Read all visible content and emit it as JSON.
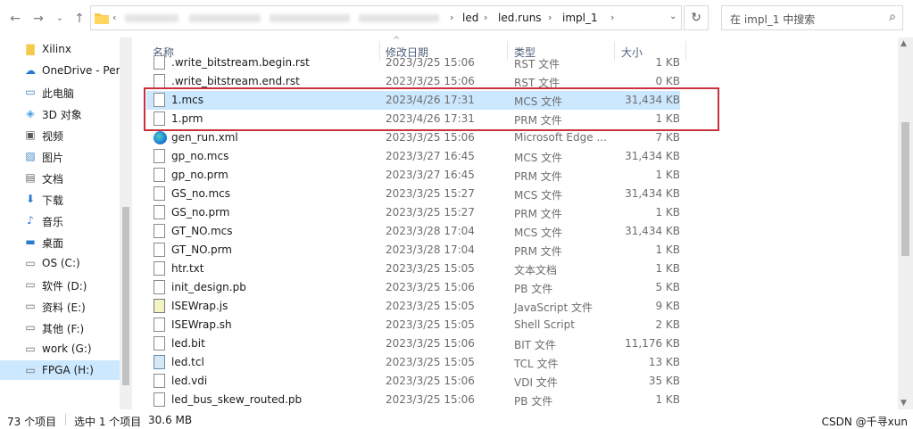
{
  "address": {
    "crumbs": [
      "led",
      "led.runs",
      "impl_1"
    ],
    "search_placeholder": "在 impl_1 中搜索"
  },
  "nav": [
    {
      "label": "Xilinx",
      "icon": "folder-icon",
      "indent": 1
    },
    {
      "label": "OneDrive - Perso",
      "icon": "cloud-icon",
      "indent": 1
    },
    {
      "label": "此电脑",
      "icon": "computer-icon",
      "indent": 1
    },
    {
      "label": "3D 对象",
      "icon": "cube-icon",
      "indent": 2
    },
    {
      "label": "视频",
      "icon": "video-icon",
      "indent": 2
    },
    {
      "label": "图片",
      "icon": "picture-icon",
      "indent": 2
    },
    {
      "label": "文档",
      "icon": "document-icon",
      "indent": 2
    },
    {
      "label": "下载",
      "icon": "download-icon",
      "indent": 2
    },
    {
      "label": "音乐",
      "icon": "music-icon",
      "indent": 2
    },
    {
      "label": "桌面",
      "icon": "desktop-icon",
      "indent": 2
    },
    {
      "label": "OS (C:)",
      "icon": "drive-icon",
      "indent": 2
    },
    {
      "label": "软件 (D:)",
      "icon": "drive-icon",
      "indent": 2
    },
    {
      "label": "资料 (E:)",
      "icon": "drive-icon",
      "indent": 2
    },
    {
      "label": "其他 (F:)",
      "icon": "drive-icon",
      "indent": 2
    },
    {
      "label": "work (G:)",
      "icon": "drive-icon",
      "indent": 2
    },
    {
      "label": "FPGA (H:)",
      "icon": "drive-icon",
      "indent": 2,
      "selected": true
    }
  ],
  "columns": {
    "name": "名称",
    "date": "修改日期",
    "type": "类型",
    "size": "大小"
  },
  "files": [
    {
      "name": ".write_bitstream.begin.rst",
      "date": "2023/3/25 15:06",
      "type": "RST 文件",
      "size": "1 KB",
      "icon": "file-icon"
    },
    {
      "name": ".write_bitstream.end.rst",
      "date": "2023/3/25 15:06",
      "type": "RST 文件",
      "size": "0 KB",
      "icon": "file-icon"
    },
    {
      "name": "1.mcs",
      "date": "2023/4/26 17:31",
      "type": "MCS 文件",
      "size": "31,434 KB",
      "icon": "file-icon",
      "selected": true
    },
    {
      "name": "1.prm",
      "date": "2023/4/26 17:31",
      "type": "PRM 文件",
      "size": "1 KB",
      "icon": "file-icon"
    },
    {
      "name": "gen_run.xml",
      "date": "2023/3/25 15:06",
      "type": "Microsoft Edge ...",
      "size": "7 KB",
      "icon": "edge-icon"
    },
    {
      "name": "gp_no.mcs",
      "date": "2023/3/27 16:45",
      "type": "MCS 文件",
      "size": "31,434 KB",
      "icon": "file-icon"
    },
    {
      "name": "gp_no.prm",
      "date": "2023/3/27 16:45",
      "type": "PRM 文件",
      "size": "1 KB",
      "icon": "file-icon"
    },
    {
      "name": "GS_no.mcs",
      "date": "2023/3/25 15:27",
      "type": "MCS 文件",
      "size": "31,434 KB",
      "icon": "file-icon"
    },
    {
      "name": "GS_no.prm",
      "date": "2023/3/25 15:27",
      "type": "PRM 文件",
      "size": "1 KB",
      "icon": "file-icon"
    },
    {
      "name": "GT_NO.mcs",
      "date": "2023/3/28 17:04",
      "type": "MCS 文件",
      "size": "31,434 KB",
      "icon": "file-icon"
    },
    {
      "name": "GT_NO.prm",
      "date": "2023/3/28 17:04",
      "type": "PRM 文件",
      "size": "1 KB",
      "icon": "file-icon"
    },
    {
      "name": "htr.txt",
      "date": "2023/3/25 15:05",
      "type": "文本文档",
      "size": "1 KB",
      "icon": "file-icon"
    },
    {
      "name": "init_design.pb",
      "date": "2023/3/25 15:06",
      "type": "PB 文件",
      "size": "5 KB",
      "icon": "file-icon"
    },
    {
      "name": "ISEWrap.js",
      "date": "2023/3/25 15:05",
      "type": "JavaScript 文件",
      "size": "9 KB",
      "icon": "js-icon"
    },
    {
      "name": "ISEWrap.sh",
      "date": "2023/3/25 15:05",
      "type": "Shell Script",
      "size": "2 KB",
      "icon": "file-icon"
    },
    {
      "name": "led.bit",
      "date": "2023/3/25 15:06",
      "type": "BIT 文件",
      "size": "11,176 KB",
      "icon": "file-icon"
    },
    {
      "name": "led.tcl",
      "date": "2023/3/25 15:05",
      "type": "TCL 文件",
      "size": "13 KB",
      "icon": "tcl-icon"
    },
    {
      "name": "led.vdi",
      "date": "2023/3/25 15:06",
      "type": "VDI 文件",
      "size": "35 KB",
      "icon": "file-icon"
    },
    {
      "name": "led_bus_skew_routed.pb",
      "date": "2023/3/25 15:06",
      "type": "PB 文件",
      "size": "1 KB",
      "icon": "file-icon"
    }
  ],
  "status": {
    "count": "73 个项目",
    "selection": "选中 1 个项目",
    "size": "30.6 MB",
    "watermark": "CSDN @千寻xun"
  }
}
